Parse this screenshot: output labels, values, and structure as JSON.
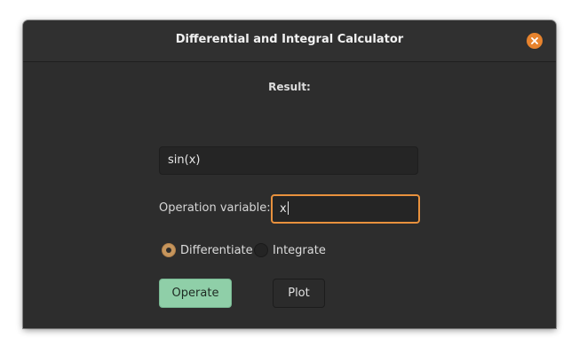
{
  "window": {
    "title": "Differential and Integral Calculator"
  },
  "result": {
    "label": "Result:"
  },
  "expression": {
    "value": "sin(x)"
  },
  "variable": {
    "label": "Operation variable:",
    "value": "x"
  },
  "mode": {
    "options": [
      "Differentiate",
      "Integrate"
    ],
    "selected": "Differentiate"
  },
  "buttons": {
    "operate": "Operate",
    "plot": "Plot"
  },
  "colors": {
    "accent": "#e8913d",
    "close": "#e7832d",
    "operate_bg": "#8fcfa8",
    "radio_selected": "#c6955c",
    "window_bg": "#2d2d2d"
  }
}
